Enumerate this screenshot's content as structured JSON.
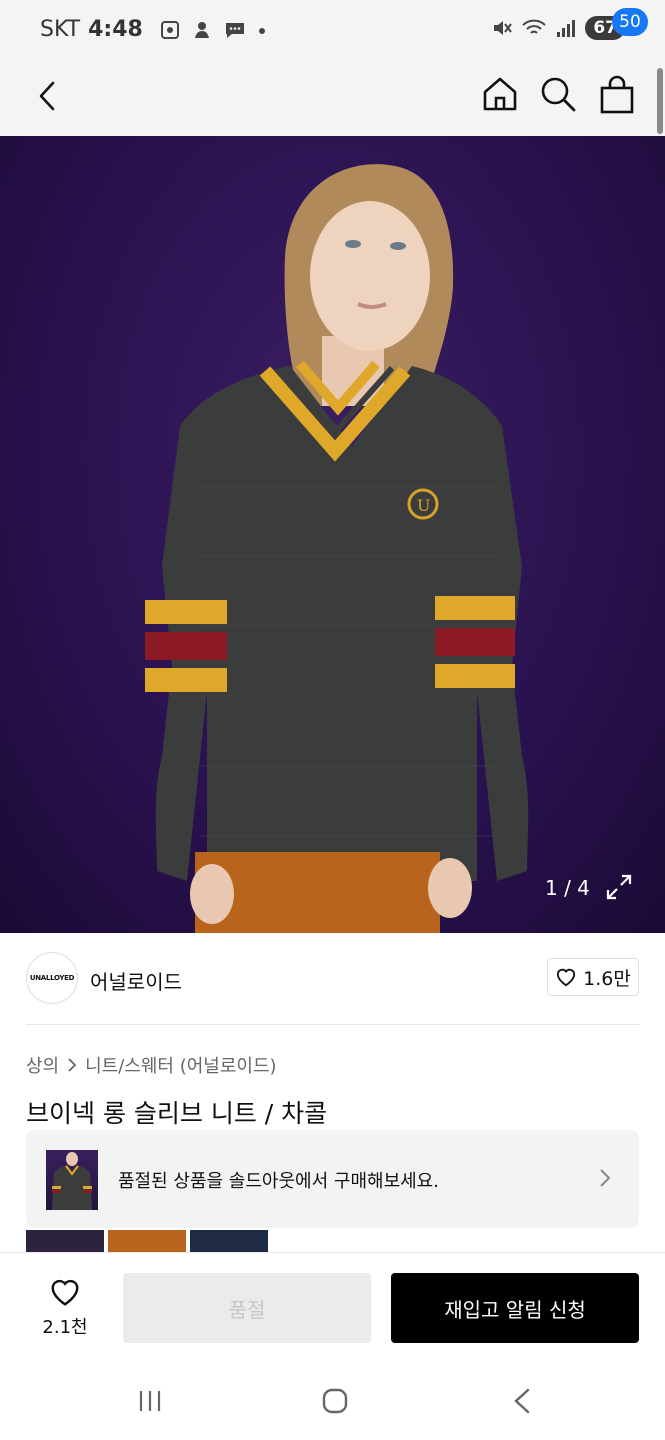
{
  "status": {
    "carrier": "SKT",
    "time": "4:48",
    "battery": "67",
    "icons": [
      "screenshot-icon",
      "notification-app-icon",
      "chat-icon",
      "dot-icon",
      "mute-icon",
      "wifi-icon",
      "signal-icon"
    ]
  },
  "header": {
    "cart_count": "50",
    "icons": [
      "back-icon",
      "home-icon",
      "search-icon",
      "shopping-bag-icon"
    ]
  },
  "gallery": {
    "counter": "1 / 4",
    "expand_icon": "expand-icon"
  },
  "brand": {
    "logo_text": "UNALLOYED",
    "name": "어널로이드",
    "likes": "1.6만"
  },
  "breadcrumb": [
    "상의",
    "니트/스웨터 (어널로이드)"
  ],
  "product": {
    "title": "브이넥 롱 슬리브 니트 / 차콜"
  },
  "soldout_banner": {
    "text": "품절된 상품을 솔드아웃에서 구매해보세요."
  },
  "bottom": {
    "wish_count": "2.1천",
    "soldout_label": "품절",
    "restock_label": "재입고 알림 신청"
  },
  "colors": {
    "accent_blue": "#1877f2",
    "sweater_charcoal": "#3a3d3c",
    "stripe_mustard": "#e0a82a",
    "stripe_burgundy": "#8b1a24",
    "background_purple": "#2a1250"
  }
}
